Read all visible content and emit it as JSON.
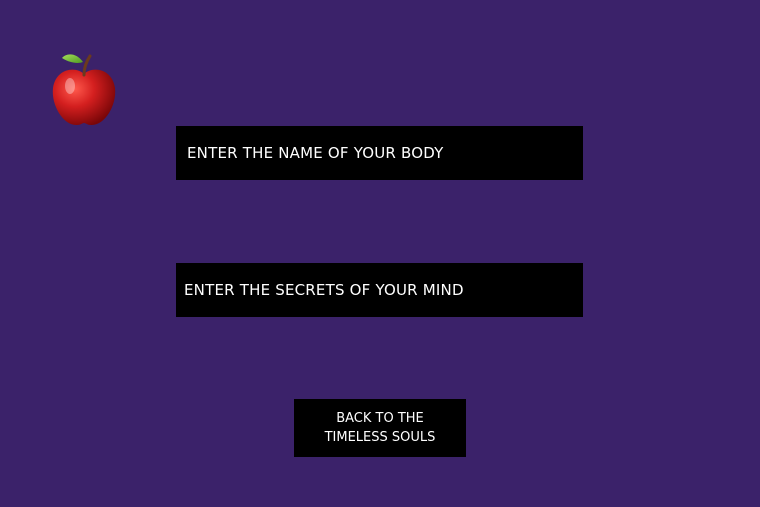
{
  "logo": {
    "icon": "red-apple-icon",
    "colors": {
      "apple_body": "#c4161c",
      "leaf": "#7cc242",
      "stem": "#6b3a1e"
    }
  },
  "form": {
    "name_placeholder": "ENTER THE NAME OF YOUR BODY",
    "secret_placeholder": "ENTER THE SECRETS OF YOUR MIND"
  },
  "back_button": {
    "line1": "BACK TO THE",
    "line2": "TIMELESS SOULS"
  },
  "theme": {
    "background": "#3b226a",
    "field_background": "#000000",
    "text": "#ffffff"
  }
}
